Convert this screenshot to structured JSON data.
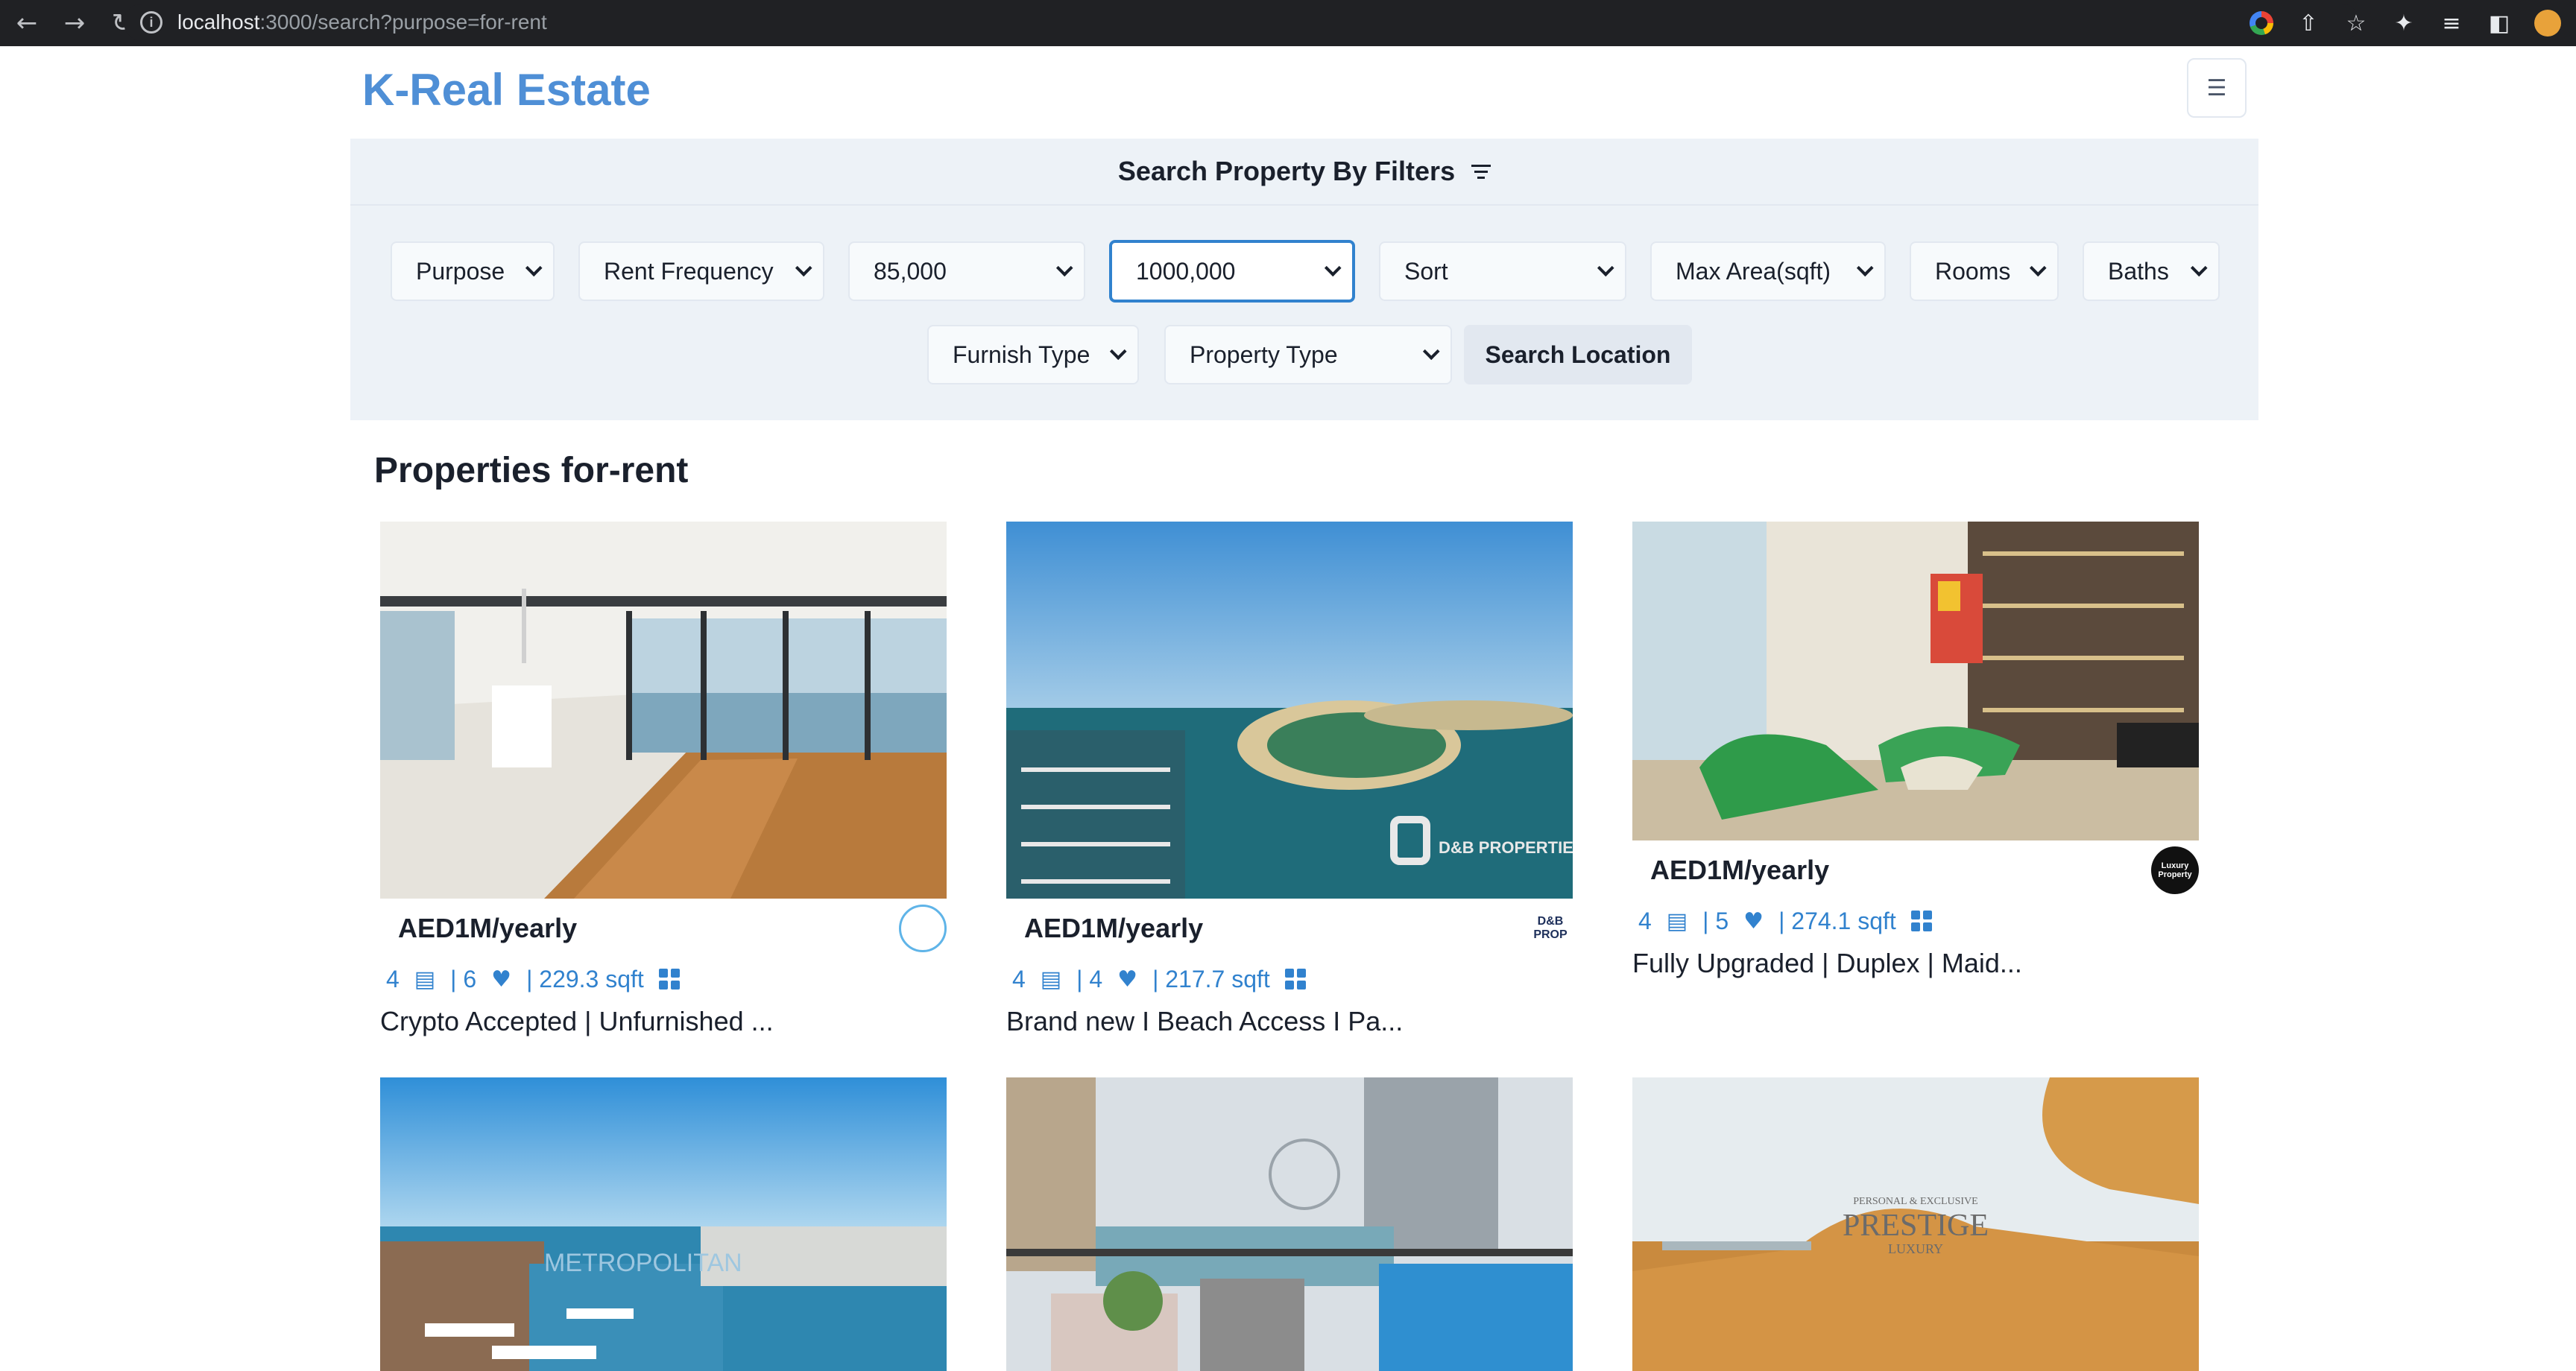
{
  "browser": {
    "url_host": "localhost",
    "url_rest": ":3000/search?purpose=for-rent"
  },
  "header": {
    "brand": "K-Real Estate"
  },
  "filters": {
    "heading": "Search Property By Filters",
    "purpose": "Purpose",
    "rent_frequency": "Rent Frequency",
    "min_price": "85,000",
    "max_price": "1000,000",
    "sort": "Sort",
    "max_area": "Max Area(sqft)",
    "rooms": "Rooms",
    "baths": "Baths",
    "furnish_type": "Furnish Type",
    "property_type": "Property Type",
    "search_location": "Search Location"
  },
  "section_title": "Properties for-rent",
  "listings": [
    {
      "price": "AED1M/yearly",
      "rooms": "4",
      "baths": "| 6",
      "area": "| 229.3 sqft",
      "title": "Crypto Accepted | Unfurnished ...",
      "agency_text": ""
    },
    {
      "price": "AED1M/yearly",
      "rooms": "4",
      "baths": "| 4",
      "area": "| 217.7 sqft",
      "title": "Brand new I Beach Access I Pa...",
      "agency_text": "D&B PROP"
    },
    {
      "price": "AED1M/yearly",
      "rooms": "4",
      "baths": "| 5",
      "area": "| 274.1 sqft",
      "title": "Fully Upgraded | Duplex | Maid...",
      "agency_text": "Luxury Property"
    }
  ],
  "watermarks": {
    "card2": "D&B PROPERTIES",
    "card4": "METROPOLITAN",
    "card6_sub": "PERSONAL & EXCLUSIVE",
    "card6_main": "PRESTIGE",
    "card6_small": "LUXURY"
  }
}
